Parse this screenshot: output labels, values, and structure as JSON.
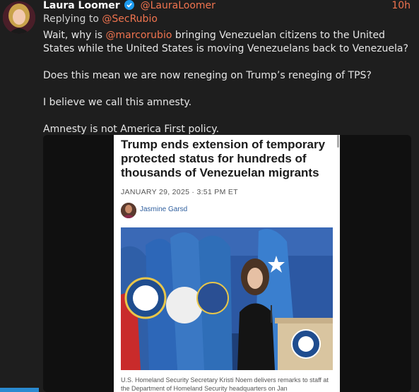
{
  "tweet": {
    "display_name": "Laura Loomer",
    "handle": "@LauraLoomer",
    "time": "10h",
    "replying_prefix": "Replying to ",
    "replying_to": "@SecRubio",
    "line1_pre": "Wait, why is ",
    "line1_mention": "@marcorubio",
    "line1_post": " bringing Venezuelan citizens to the United States while the United States is moving Venezuelans back to Venezuela?",
    "p2": "Does this mean we are now reneging on Trump’s reneging of TPS?",
    "p3": "I believe we call this amnesty.",
    "p4": "Amnesty is not America First policy."
  },
  "article": {
    "headline": "Trump ends extension of temporary protected status for hundreds of thousands of Venezuelan migrants",
    "dateline": "JANUARY 29, 2025 · 3:51 PM ET",
    "author": "Jasmine Garsd",
    "caption": "U.S. Homeland Security Secretary Kristi Noem delivers remarks to staff at the Department of Homeland Security headquarters on Jan"
  },
  "colors": {
    "background": "#1e1e1e",
    "accent": "#f0744f",
    "verified": "#1d9bf0",
    "author_link": "#2f5f9e"
  }
}
